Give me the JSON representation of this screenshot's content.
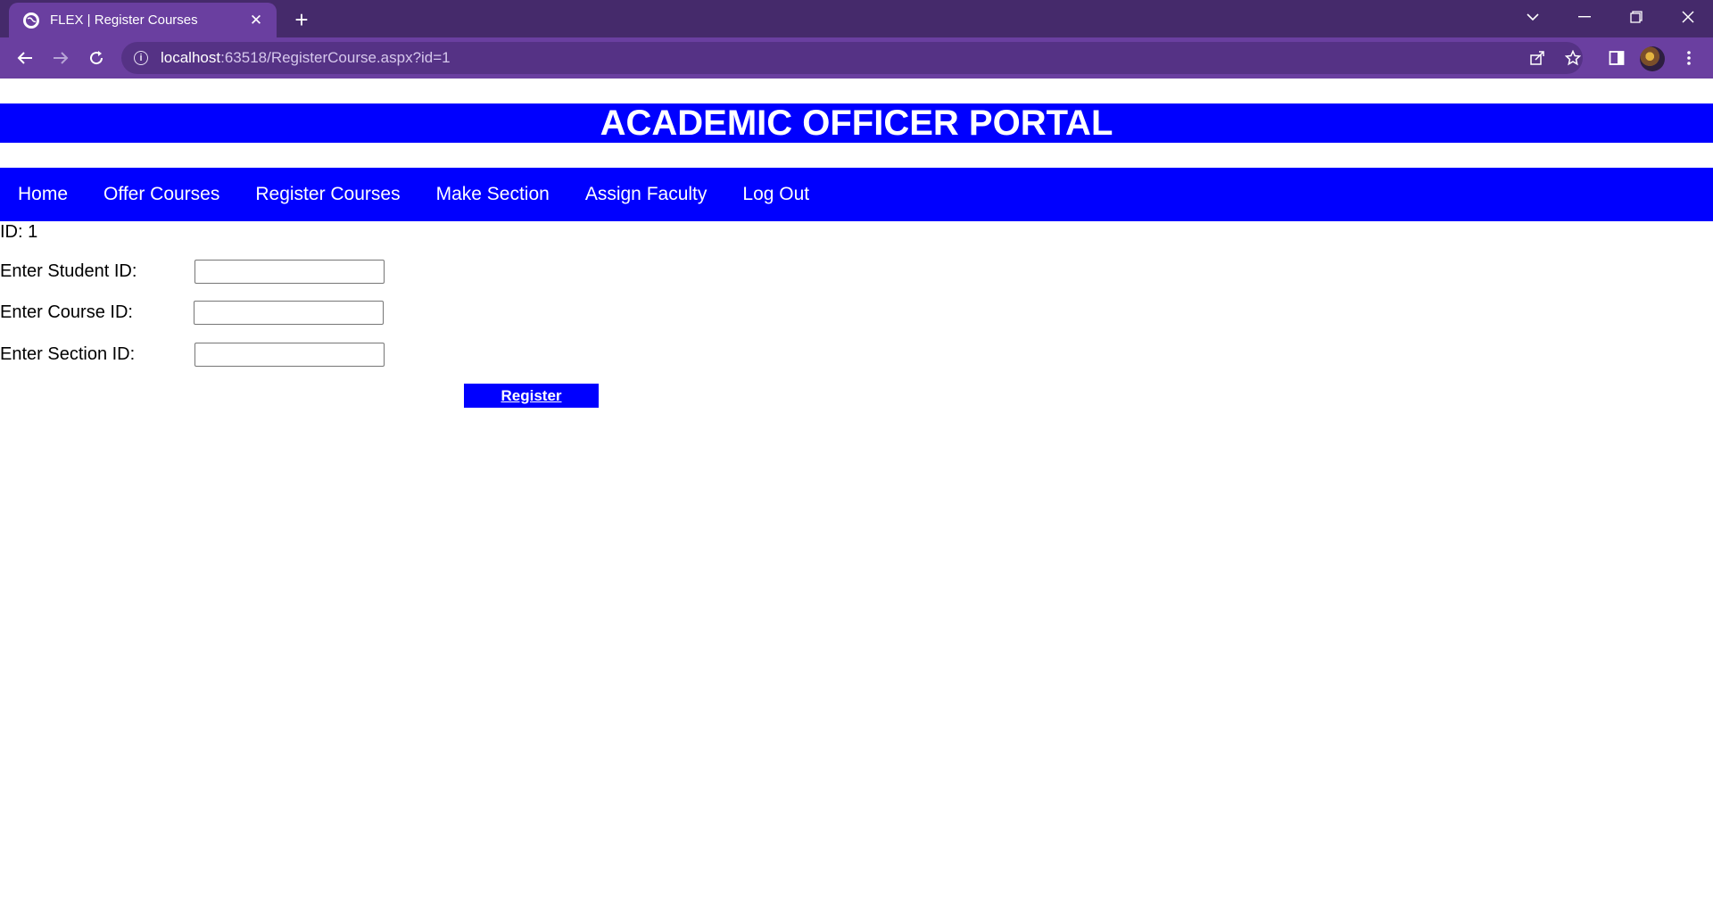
{
  "browser": {
    "tab_title": "FLEX | Register Courses",
    "url_host": "localhost",
    "url_rest": ":63518/RegisterCourse.aspx?id=1",
    "colors": {
      "tabbar": "#452a6b",
      "toolbar": "#6a3fa0",
      "omnibox": "#553285"
    }
  },
  "header": {
    "title": "ACADEMIC OFFICER PORTAL",
    "color": "#0000ff"
  },
  "menu": {
    "items": [
      {
        "label": "Home"
      },
      {
        "label": "Offer Courses"
      },
      {
        "label": "Register Courses"
      },
      {
        "label": "Make Section"
      },
      {
        "label": "Assign Faculty"
      },
      {
        "label": "Log Out"
      }
    ]
  },
  "id_label": "ID: 1",
  "form": {
    "student": {
      "label": "Enter Student ID:",
      "value": ""
    },
    "course": {
      "label": "Enter Course ID:",
      "value": ""
    },
    "section": {
      "label": "Enter Section ID:",
      "value": ""
    },
    "submit_label": "Register"
  }
}
